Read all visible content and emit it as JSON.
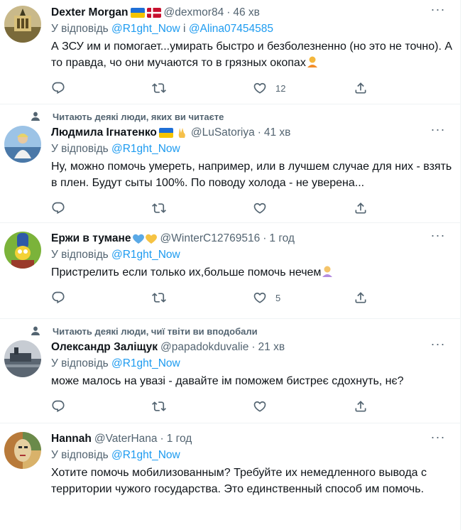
{
  "tweets": [
    {
      "context": "",
      "name": "Dexter Morgan",
      "handle": "@dexmor84",
      "time": "46 хв",
      "reply_prefix": "У відповідь",
      "reply_mention_1": "@R1ght_Now",
      "reply_joiner": "і",
      "reply_mention_2": "@Alina07454585",
      "text": "А ЗСУ им и помогает...умирать быстро и безболезненно (но это не точно). А то правда, чо они мучаются то в грязных окопах",
      "likes": "12"
    },
    {
      "context": "Читають деякі люди, яких ви читаєте",
      "name": "Людмила Ігнатенко",
      "handle": "@LuSatoriya",
      "time": "41 хв",
      "reply_prefix": "У відповідь",
      "reply_mention_1": "@R1ght_Now",
      "text": "Ну, можно помочь умереть, например, или в лучшем случае для них - взять в плен. Будут сыты 100%. По поводу холода - не уверена...",
      "likes": ""
    },
    {
      "context": "",
      "name": "Ержи в тумане",
      "handle": "@WinterC12769516",
      "time": "1 год",
      "reply_prefix": "У відповідь",
      "reply_mention_1": "@R1ght_Now",
      "text": "Пристрелить если только их,больше помочь нечем",
      "likes": "5"
    },
    {
      "context": "Читають деякі люди, чиї твіти ви вподобали",
      "name": "Олександр Заліщук",
      "handle": "@papadokduvalie",
      "time": "21 хв",
      "reply_prefix": "У відповідь",
      "reply_mention_1": "@R1ght_Now",
      "text": "може малось на увазі - давайте ім поможем бистреє сдохнуть, нє?",
      "likes": ""
    },
    {
      "context": "",
      "name": "Hannah",
      "handle": "@VaterHana",
      "time": "1 год",
      "reply_prefix": "У відповідь",
      "reply_mention_1": "@R1ght_Now",
      "text": "Хотите помочь мобилизованным? Требуйте их немедленного вывода с территории чужого государства. Это единственный способ им помочь.",
      "likes": ""
    }
  ],
  "icons": {
    "reply": "comment-icon",
    "retweet": "retweet-icon",
    "like": "heart-icon",
    "share": "share-icon",
    "more": "more-icon"
  },
  "colors": {
    "accent": "#1d9bf0",
    "muted": "#536471",
    "text": "#0f1419",
    "divider": "#eff3f4"
  }
}
